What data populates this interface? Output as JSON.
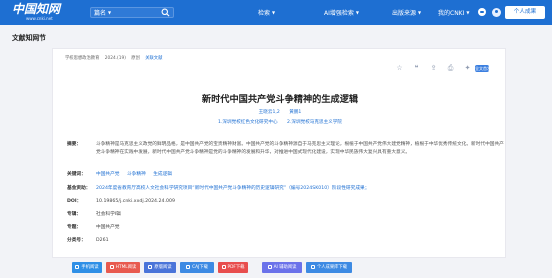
{
  "header": {
    "brand_cn": "中国知网",
    "brand_en": "www.cnki.net",
    "search_scope": "篇名",
    "nav": [
      "检索",
      "AI增强检索",
      "出版来源",
      "我的CNKI"
    ],
    "profile_button": "个人成果"
  },
  "section": {
    "title": "文献知网节"
  },
  "meta": {
    "items": [
      "学校思想政治教育",
      "2024.(19)",
      "原创",
      "关联文献"
    ]
  },
  "article": {
    "title": "新时代中国共产党斗争精神的生成逻辑",
    "authors": [
      "王晓云1,2",
      "黄鹏1"
    ],
    "affiliations": [
      "1.深圳党校红色文化研究中心",
      "2.深圳党校马克思主义学院"
    ],
    "abstract_label": "摘要：",
    "abstract": "斗争精神是马克思主义政党的鲜明品格，是中国共产党的宝贵精神财富。中国共产党的斗争精神源自于马克思主义理论，根植于中国共产党伟大建党精神，植根于中华优秀传统文化。新时代中国共产党斗争精神在实践中发展，新时代中国共产党斗争精神是党的斗争精神的发展和升华，对推进中国式现代化建设，实现中华民族伟大复兴具有重大意义。",
    "keywords_label": "关键词：",
    "keywords": [
      "中国共产党",
      "斗争精神",
      "生成逻辑"
    ],
    "fund_label": "基金资助：",
    "fund": "2024年度省教育厅高校人文社会科学研究项目“新时代中国共产党斗争精神的历史逻辑研究”（编号2024SK010）阶段性研究成果；",
    "doi_label": "DOI：",
    "doi": "10.19865/j.cnki.xxdj.2024.24.009",
    "series_label": "专辑：",
    "series": "社会科学Ⅰ辑",
    "topic_label": "专题：",
    "topic": "中国共产党",
    "class_label": "分类号：",
    "class_no": "D261"
  },
  "tool_icons": [
    "star-icon",
    "quote-icon",
    "share-icon",
    "print-icon",
    "bookmark-icon"
  ],
  "badge": "全文首发",
  "buttons": [
    {
      "label": "手机阅读",
      "color": "#2f8fe6"
    },
    {
      "label": "HTML阅读",
      "color": "#e85a4f"
    },
    {
      "label": "原版阅读",
      "color": "#4a74d9"
    },
    {
      "label": "CAJ下载",
      "color": "#3d8ae3"
    },
    {
      "label": "PDF下载",
      "color": "#e84e4e"
    },
    {
      "label": "AI 辅助阅读",
      "color": "#6b72ea"
    },
    {
      "label": "个人成果库下载",
      "color": "#3d8ae3"
    }
  ]
}
